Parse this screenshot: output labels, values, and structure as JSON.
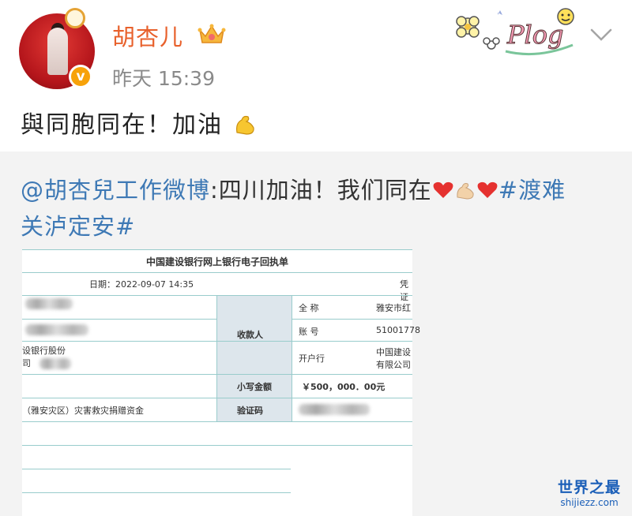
{
  "header": {
    "username": "胡杏儿",
    "timestamp": "昨天 15:39",
    "verified_mark": "v",
    "badge_text": "Plog"
  },
  "post": {
    "text": "與同胞同在！加油"
  },
  "repost": {
    "mention": "@胡杏兒工作微博",
    "text": ":四川加油！我们同在",
    "hashtag_line1": "#渡难",
    "hashtag_line2": "关泸定安#"
  },
  "receipt": {
    "title": "中国建设银行网上银行电子回执单",
    "date_label": "日期：2022-09-07 14:35",
    "voucher_label": "凭证",
    "payer_bank_partial": "设银行股份",
    "payer_bank_partial2": "司",
    "payee_label": "收款人",
    "full_name_label": "全  称",
    "full_name_value": "雅安市红",
    "account_label": "账  号",
    "account_value": "51001778",
    "bank_label": "开户行",
    "bank_value_1": "中国建设",
    "bank_value_2": "有限公司",
    "amount_label": "小写金额",
    "amount_value": "￥500，000．00元",
    "purpose_value": "（雅安灾区）灾害救灾捐赠资金",
    "verify_label": "验证码"
  },
  "watermark": {
    "top": "世界之最",
    "bottom": "shijiezz.com"
  },
  "colors": {
    "username": "#e8612c",
    "link": "#3e79b5",
    "repost_bg": "#f3f3f3",
    "verified": "#f7a20a"
  },
  "icons": [
    "crown-icon",
    "plog-badge-icon",
    "chevron-down-icon",
    "flexed-biceps-icon",
    "heart-icon"
  ]
}
